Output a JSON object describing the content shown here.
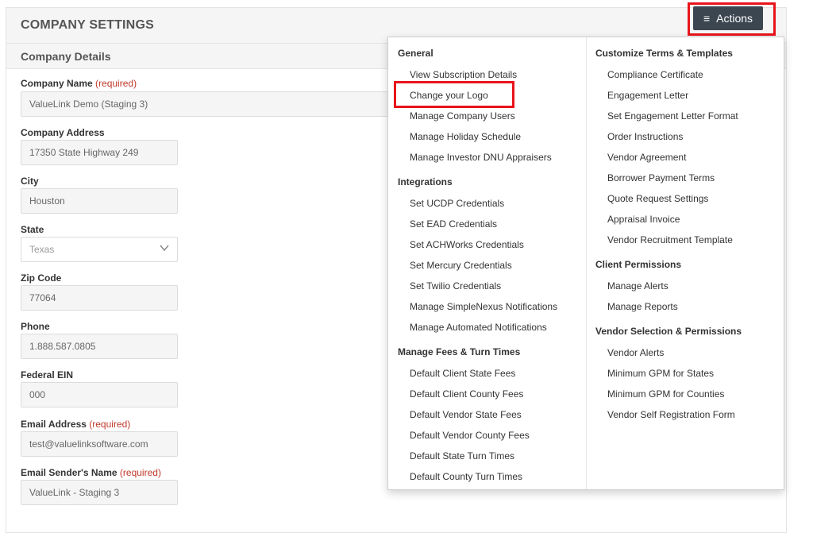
{
  "header": {
    "title": "COMPANY SETTINGS",
    "actions_label": "Actions"
  },
  "subheader": {
    "title": "Company Details"
  },
  "form": {
    "company_name": {
      "label": "Company Name",
      "required": "(required)",
      "value": "ValueLink Demo (Staging 3)"
    },
    "company_address": {
      "label": "Company Address",
      "value": "17350 State Highway 249"
    },
    "city": {
      "label": "City",
      "value": "Houston"
    },
    "state": {
      "label": "State",
      "value": "Texas"
    },
    "zip": {
      "label": "Zip Code",
      "value": "77064"
    },
    "phone": {
      "label": "Phone",
      "value": "1.888.587.0805"
    },
    "ein": {
      "label": "Federal EIN",
      "value": "000"
    },
    "email": {
      "label": "Email Address",
      "required": "(required)",
      "value": "test@valuelinksoftware.com"
    },
    "sender": {
      "label": "Email Sender's Name",
      "required": "(required)",
      "value": "ValueLink - Staging 3"
    }
  },
  "menu": {
    "general": {
      "title": "General",
      "items": [
        "View Subscription Details",
        "Change your Logo",
        "Manage Company Users",
        "Manage Holiday Schedule",
        "Manage Investor DNU Appraisers"
      ]
    },
    "integrations": {
      "title": "Integrations",
      "items": [
        "Set UCDP Credentials",
        "Set EAD Credentials",
        "Set ACHWorks Credentials",
        "Set Mercury Credentials",
        "Set Twilio Credentials",
        "Manage SimpleNexus Notifications",
        "Manage Automated Notifications"
      ]
    },
    "fees": {
      "title": "Manage Fees & Turn Times",
      "items": [
        "Default Client State Fees",
        "Default Client County Fees",
        "Default Vendor State Fees",
        "Default Vendor County Fees",
        "Default State Turn Times",
        "Default County Turn Times"
      ]
    },
    "terms": {
      "title": "Customize Terms & Templates",
      "items": [
        "Compliance Certificate",
        "Engagement Letter",
        "Set Engagement Letter Format",
        "Order Instructions",
        "Vendor Agreement",
        "Borrower Payment Terms",
        "Quote Request Settings",
        "Appraisal Invoice",
        "Vendor Recruitment Template"
      ]
    },
    "client_permissions": {
      "title": "Client Permissions",
      "items": [
        "Manage Alerts",
        "Manage Reports"
      ]
    },
    "vendor_selection": {
      "title": "Vendor Selection & Permissions",
      "items": [
        "Vendor Alerts",
        "Minimum GPM for States",
        "Minimum GPM for Counties",
        "Vendor Self Registration Form"
      ]
    }
  },
  "colors": {
    "highlight": "#e8141a",
    "actions_bg": "#3b4650",
    "required": "#c0392b"
  }
}
